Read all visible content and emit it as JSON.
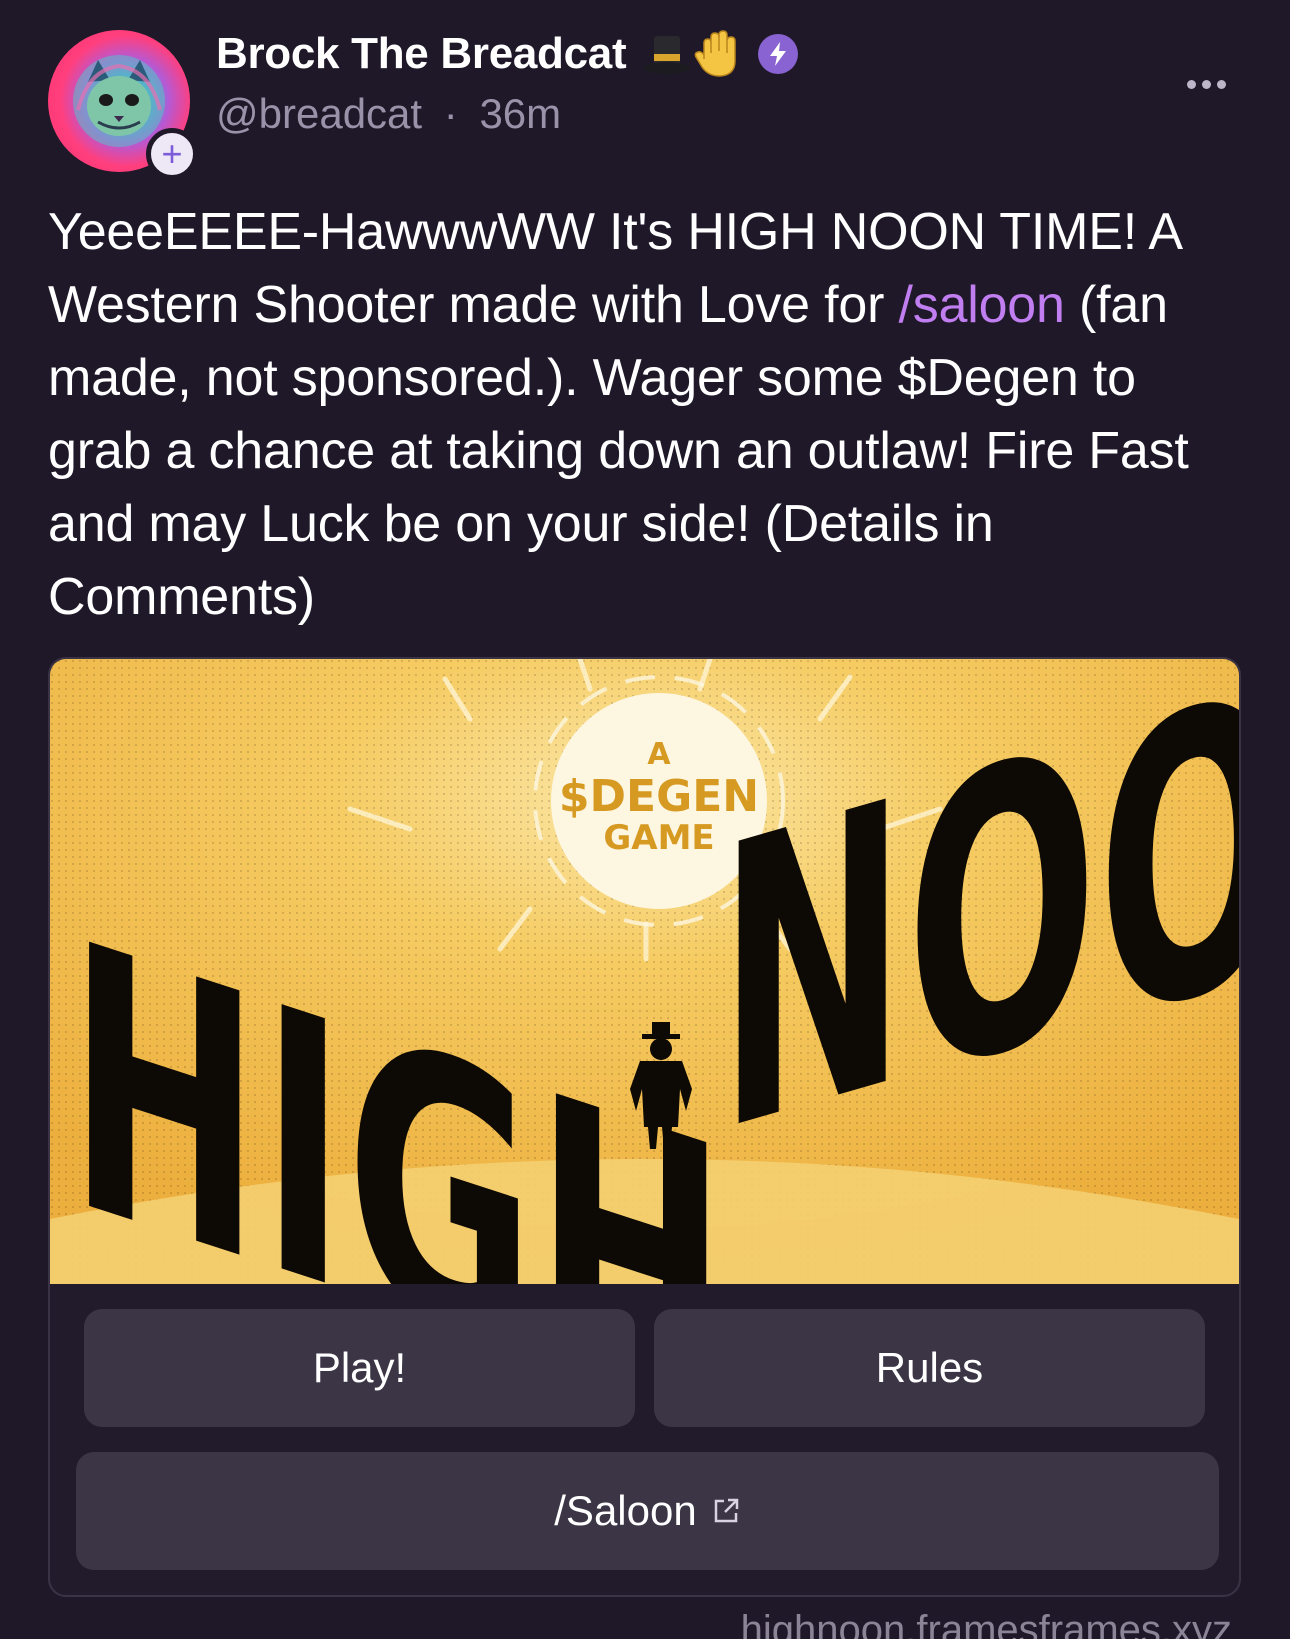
{
  "author": {
    "display_name": "Brock The Breadcat",
    "emoji_names": [
      "top-hat-emoji",
      "raised-hand-emoji"
    ],
    "handle": "@breadcat",
    "separator": "·",
    "time_ago": "36m",
    "follow_symbol": "+"
  },
  "post": {
    "text_part1": "YeeeEEEE-HawwwWW It's HIGH NOON TIME! A Western Shooter made with Love for ",
    "channel_link": "/saloon",
    "text_part2": " (fan made, not sponsored.). Wager some $Degen to grab a chance at taking down an outlaw!  Fire Fast and may Luck be on your side! (Details in Comments)"
  },
  "frame": {
    "image": {
      "title_left": "HIGH",
      "title_right": "NOON",
      "sun_line1": "A",
      "sun_line2": "$DEGEN",
      "sun_line3": "GAME"
    },
    "buttons": {
      "play": "Play!",
      "rules": "Rules",
      "saloon": "/Saloon"
    },
    "domain": "highnoon.framesframes.xyz"
  },
  "colors": {
    "background": "#1f1829",
    "accent_link": "#c07ef0",
    "power_badge": "#8a63d2",
    "button_bg": "#3b3546",
    "image_yellow": "#f2bf4c"
  }
}
